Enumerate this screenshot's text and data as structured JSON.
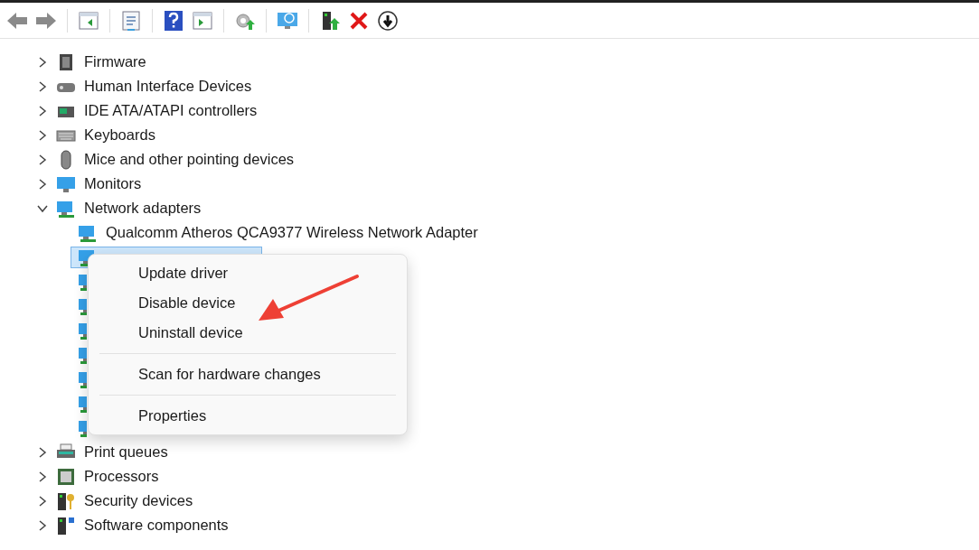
{
  "tree": [
    {
      "label": "Firmware",
      "expanded": false
    },
    {
      "label": "Human Interface Devices",
      "expanded": false
    },
    {
      "label": "IDE ATA/ATAPI controllers",
      "expanded": false
    },
    {
      "label": "Keyboards",
      "expanded": false
    },
    {
      "label": "Mice and other pointing devices",
      "expanded": false
    },
    {
      "label": "Monitors",
      "expanded": false
    },
    {
      "label": "Network adapters",
      "expanded": true,
      "children": [
        {
          "label": "Qualcomm Atheros QCA9377 Wireless Network Adapter",
          "selected": false
        },
        {
          "selected": true
        },
        {
          "selected": false
        },
        {
          "selected": false
        },
        {
          "selected": false
        },
        {
          "selected": false
        },
        {
          "selected": false
        },
        {
          "selected": false
        },
        {
          "selected": false
        }
      ]
    },
    {
      "label": "Print queues",
      "expanded": false
    },
    {
      "label": "Processors",
      "expanded": false
    },
    {
      "label": "Security devices",
      "expanded": false
    },
    {
      "label": "Software components",
      "expanded": false
    }
  ],
  "context_menu": [
    {
      "kind": "item",
      "label": "Update driver"
    },
    {
      "kind": "item",
      "label": "Disable device"
    },
    {
      "kind": "item",
      "label": "Uninstall device"
    },
    {
      "kind": "separator"
    },
    {
      "kind": "item",
      "label": "Scan for hardware changes"
    },
    {
      "kind": "separator"
    },
    {
      "kind": "item",
      "label": "Properties"
    }
  ]
}
